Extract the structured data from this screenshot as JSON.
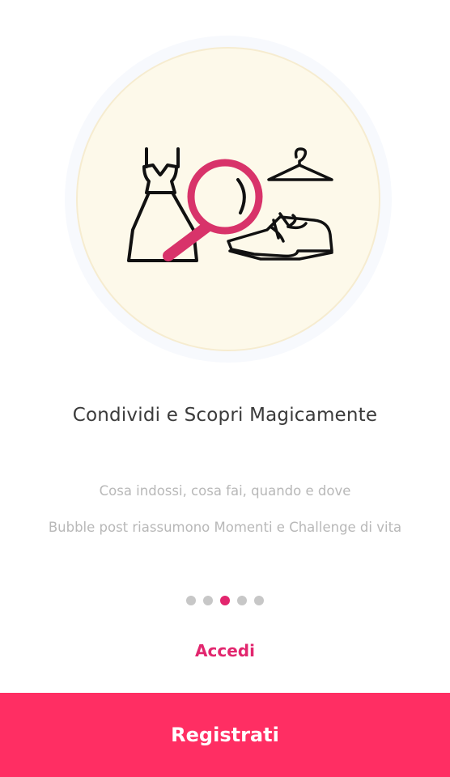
{
  "onboarding": {
    "title": "Condividi e Scopri Magicamente",
    "description_lines": [
      "Cosa indossi, cosa fai, quando e dove",
      "Bubble post riassumono Momenti e Challenge di vita"
    ],
    "pagination": {
      "total": 5,
      "active_index": 2
    },
    "illustration_icons": [
      "dress-icon",
      "magnifier-icon",
      "hanger-icon",
      "shoe-icon"
    ]
  },
  "actions": {
    "login_label": "Accedi",
    "register_label": "Registrati"
  },
  "colors": {
    "accent": "#e2266e",
    "button_background": "#ff2e63",
    "circle_fill": "#fdf9ea",
    "dot_inactive": "#c7c7c7"
  }
}
